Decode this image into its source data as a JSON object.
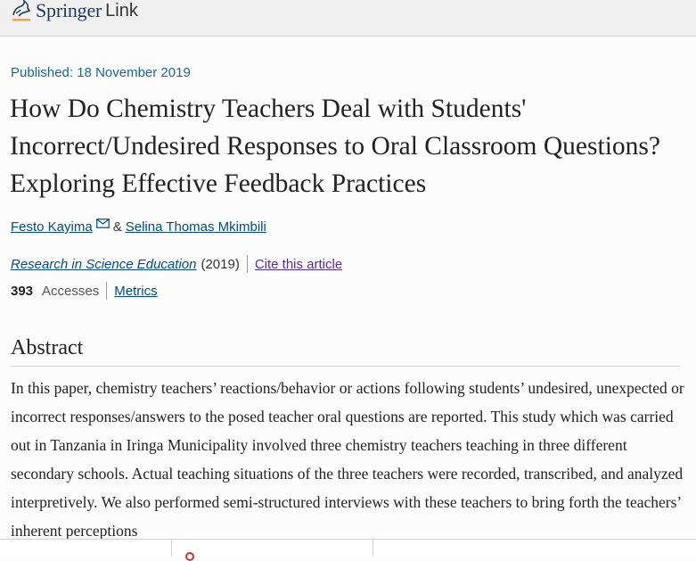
{
  "header": {
    "brand": "Springer",
    "brand_suffix": "Link",
    "logo_icon": "springer-horse-icon",
    "brand_color": "#1d3a5c",
    "accent_color": "#f0a24a"
  },
  "article": {
    "published": "Published: 18 November 2019",
    "title": "How Do Chemistry Teachers Deal with Students' Incorrect/Undesired Responses to Oral Classroom Questions? Exploring Effective Feedback Practices",
    "authors": [
      {
        "name": "Festo Kayima",
        "has_email": true
      },
      {
        "name": "Selina Thomas Mkimbili",
        "has_email": false
      }
    ],
    "author_separator": "&",
    "journal": "Research in Science Education",
    "year": "(2019)",
    "cite_label": "Cite this article",
    "accesses_count": "393",
    "accesses_label": "Accesses",
    "metrics_label": "Metrics"
  },
  "abstract": {
    "heading": "Abstract",
    "text": "In this paper, chemistry teachers’ reactions/behavior or actions following students’ undesired, unexpected or incorrect responses/answers to the posed teacher oral questions are reported. This study which was carried out in Tanzania in Iringa Municipality involved three chemistry teachers teaching in three different secondary schools. Actual teaching situations of the three teachers were recorded, transcribed, and analyzed interpretively. We also performed semi-structured interviews with these teachers to bring forth the teachers’ inherent perceptions"
  },
  "colors": {
    "link": "#024b7a",
    "visited_link": "#5a2c86",
    "published": "#1d6590"
  }
}
